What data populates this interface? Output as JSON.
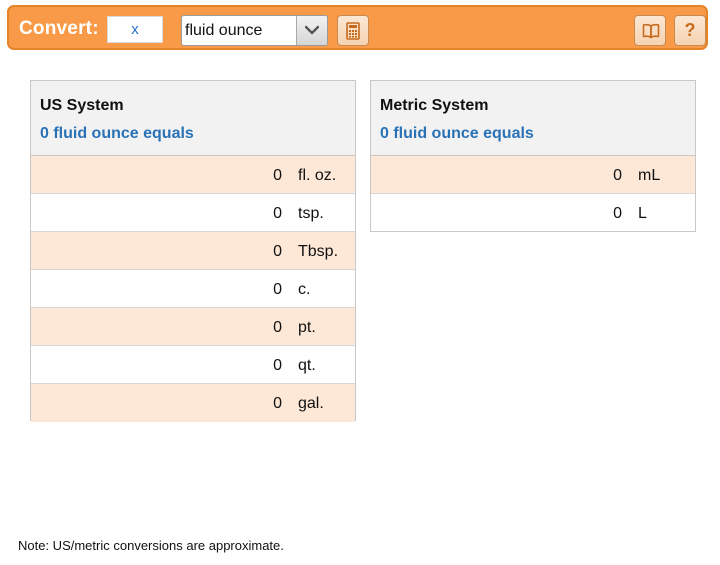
{
  "toolbar": {
    "convert_label": "Convert:",
    "input_value": "x",
    "selected_unit": "fluid ounce",
    "help_label": "?",
    "icons": {
      "dropdown": "chevron-down-icon",
      "calculator": "calculator-icon",
      "book": "book-icon"
    },
    "colors": {
      "bar": "#f89a48",
      "border": "#e58327"
    }
  },
  "us_system": {
    "title": "US System",
    "subtitle": "0 fluid ounce equals",
    "rows": [
      {
        "value": "0",
        "unit": "fl. oz."
      },
      {
        "value": "0",
        "unit": "tsp."
      },
      {
        "value": "0",
        "unit": "Tbsp."
      },
      {
        "value": "0",
        "unit": "c."
      },
      {
        "value": "0",
        "unit": "pt."
      },
      {
        "value": "0",
        "unit": "qt."
      },
      {
        "value": "0",
        "unit": "gal."
      }
    ]
  },
  "metric_system": {
    "title": "Metric System",
    "subtitle": "0 fluid ounce equals",
    "rows": [
      {
        "value": "0",
        "unit": "mL"
      },
      {
        "value": "0",
        "unit": "L"
      }
    ]
  },
  "note": "Note: US/metric conversions are approximate.",
  "colors": {
    "accent_text": "#2a72b6",
    "row_alt": "#fde8d8",
    "header_bg": "#f2f2f2"
  }
}
